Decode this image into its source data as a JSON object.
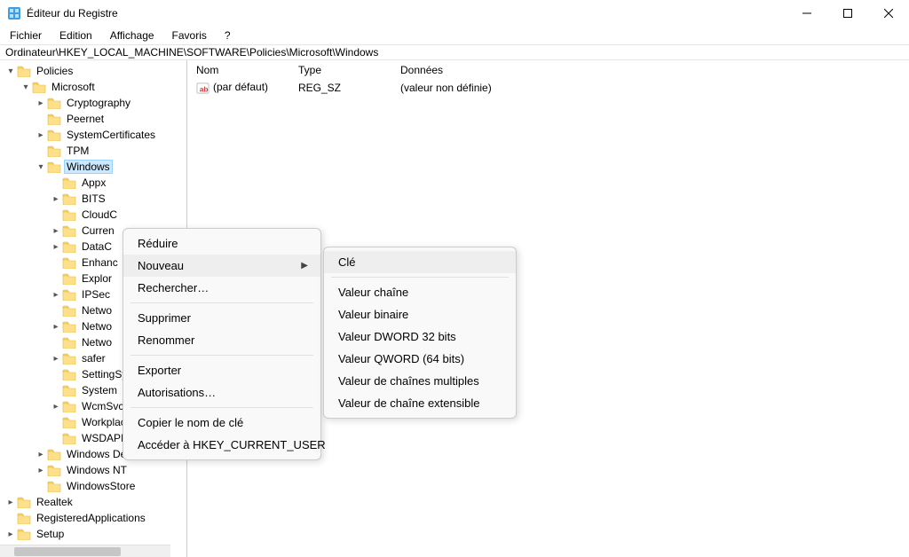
{
  "window": {
    "title": "Éditeur du Registre"
  },
  "menubar": {
    "fichier": "Fichier",
    "edition": "Edition",
    "affichage": "Affichage",
    "favoris": "Favoris",
    "aide": "?"
  },
  "address": "Ordinateur\\HKEY_LOCAL_MACHINE\\SOFTWARE\\Policies\\Microsoft\\Windows",
  "tree": {
    "policies": "Policies",
    "microsoft": "Microsoft",
    "cryptography": "Cryptography",
    "peernet": "Peernet",
    "systemcertificates": "SystemCertificates",
    "tpm": "TPM",
    "windows": "Windows",
    "appx": "Appx",
    "bits": "BITS",
    "cloudc": "CloudC",
    "curren": "Curren",
    "datac": "DataC",
    "enhanc": "Enhanc",
    "explor": "Explor",
    "ipsec": "IPSec",
    "netwo1": "Netwo",
    "netwo2": "Netwo",
    "netwo3": "Netwo",
    "safer": "safer",
    "settingsync": "SettingSync",
    "system": "System",
    "wcmsvc": "WcmSvc",
    "workplacejoin": "WorkplaceJoin",
    "wsdapi": "WSDAPI",
    "windowsdefender": "Windows Defender",
    "windowsnt": "Windows NT",
    "windowsstore": "WindowsStore",
    "realtek": "Realtek",
    "registeredapplications": "RegisteredApplications",
    "setup": "Setup"
  },
  "list": {
    "header_name": "Nom",
    "header_type": "Type",
    "header_data": "Données",
    "row0_name": "(par défaut)",
    "row0_type": "REG_SZ",
    "row0_data": "(valeur non définie)"
  },
  "ctx1": {
    "reduire": "Réduire",
    "nouveau": "Nouveau",
    "rechercher": "Rechercher…",
    "supprimer": "Supprimer",
    "renommer": "Renommer",
    "exporter": "Exporter",
    "autorisations": "Autorisations…",
    "copier": "Copier le nom de clé",
    "acceder": "Accéder à HKEY_CURRENT_USER"
  },
  "ctx2": {
    "cle": "Clé",
    "chaine": "Valeur chaîne",
    "binaire": "Valeur binaire",
    "dword": "Valeur DWORD 32 bits",
    "qword": "Valeur QWORD (64 bits)",
    "multi": "Valeur de chaînes multiples",
    "ext": "Valeur de chaîne extensible"
  }
}
